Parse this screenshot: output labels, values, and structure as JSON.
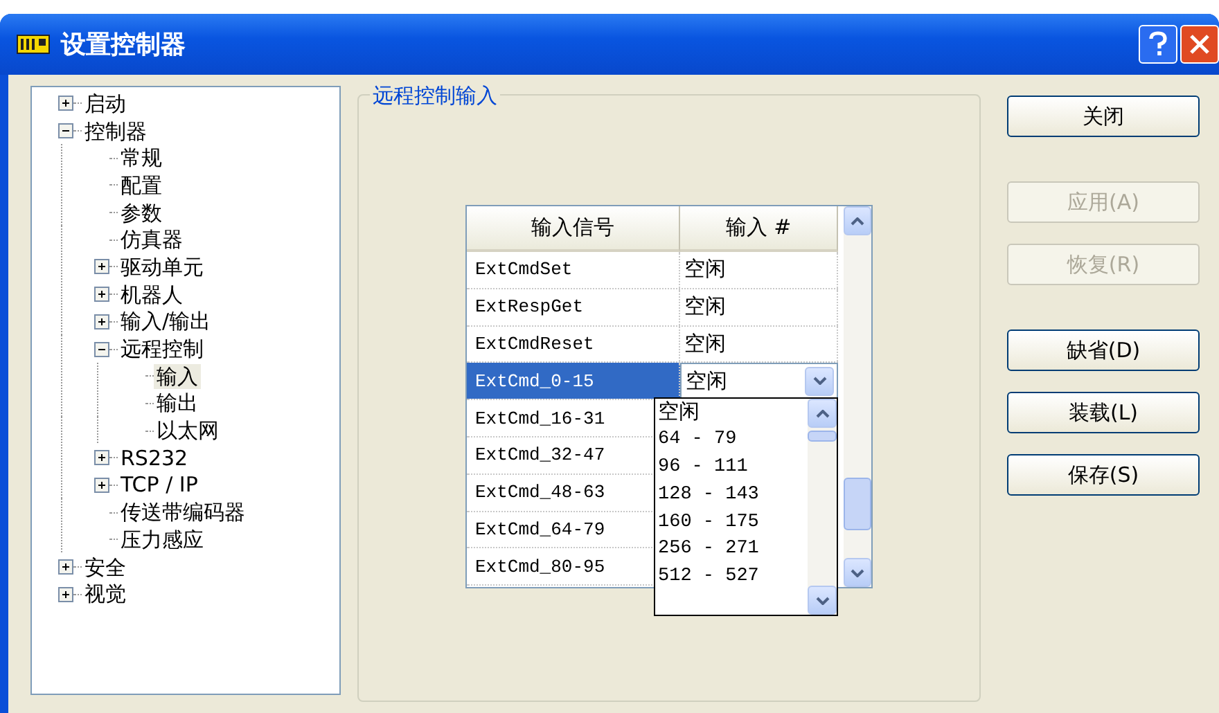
{
  "window": {
    "title": "设置控制器"
  },
  "tree": [
    {
      "label": "启动",
      "expanded": false,
      "selected": false
    },
    {
      "label": "控制器",
      "expanded": true,
      "selected": false,
      "children": [
        {
          "label": "常规",
          "selected": false
        },
        {
          "label": "配置",
          "selected": false
        },
        {
          "label": "参数",
          "selected": false
        },
        {
          "label": "仿真器",
          "selected": false
        },
        {
          "label": "驱动单元",
          "expanded": false,
          "selected": false
        },
        {
          "label": "机器人",
          "expanded": false,
          "selected": false
        },
        {
          "label": "输入/输出",
          "expanded": false,
          "selected": false
        },
        {
          "label": "远程控制",
          "expanded": true,
          "selected": false,
          "children": [
            {
              "label": "输入",
              "selected": true
            },
            {
              "label": "输出",
              "selected": false
            },
            {
              "label": "以太网",
              "selected": false
            }
          ]
        },
        {
          "label": "RS232",
          "expanded": false,
          "selected": false
        },
        {
          "label": "TCP / IP",
          "expanded": false,
          "selected": false
        },
        {
          "label": "传送带编码器",
          "selected": false
        },
        {
          "label": "压力感应",
          "selected": false
        }
      ]
    },
    {
      "label": "安全",
      "expanded": false,
      "selected": false
    },
    {
      "label": "视觉",
      "expanded": false,
      "selected": false
    }
  ],
  "group": {
    "title": "远程控制输入"
  },
  "table": {
    "columns": [
      "输入信号",
      "输入 #"
    ],
    "rows": [
      {
        "signal": "ExtCmdSet",
        "value": "空闲",
        "selected": false
      },
      {
        "signal": "ExtRespGet",
        "value": "空闲",
        "selected": false
      },
      {
        "signal": "ExtCmdReset",
        "value": "空闲",
        "selected": false
      },
      {
        "signal": "ExtCmd_0-15",
        "value": "空闲",
        "selected": true
      },
      {
        "signal": "ExtCmd_16-31",
        "selected": false
      },
      {
        "signal": "ExtCmd_32-47",
        "selected": false
      },
      {
        "signal": "ExtCmd_48-63",
        "selected": false
      },
      {
        "signal": "ExtCmd_64-79",
        "selected": false
      },
      {
        "signal": "ExtCmd_80-95",
        "selected": false
      }
    ]
  },
  "dropdown": {
    "options": [
      "空闲",
      "64 - 79",
      "96 - 111",
      "128 - 143",
      "160 - 175",
      "256 - 271",
      "512 - 527"
    ]
  },
  "buttons": [
    {
      "label": "关闭",
      "disabled": false
    },
    {
      "label": "应用(A)",
      "disabled": true
    },
    {
      "label": "恢复(R)",
      "disabled": true
    },
    {
      "label": "缺省(D)",
      "disabled": false
    },
    {
      "label": "装载(L)",
      "disabled": false
    },
    {
      "label": "保存(S)",
      "disabled": false
    }
  ]
}
